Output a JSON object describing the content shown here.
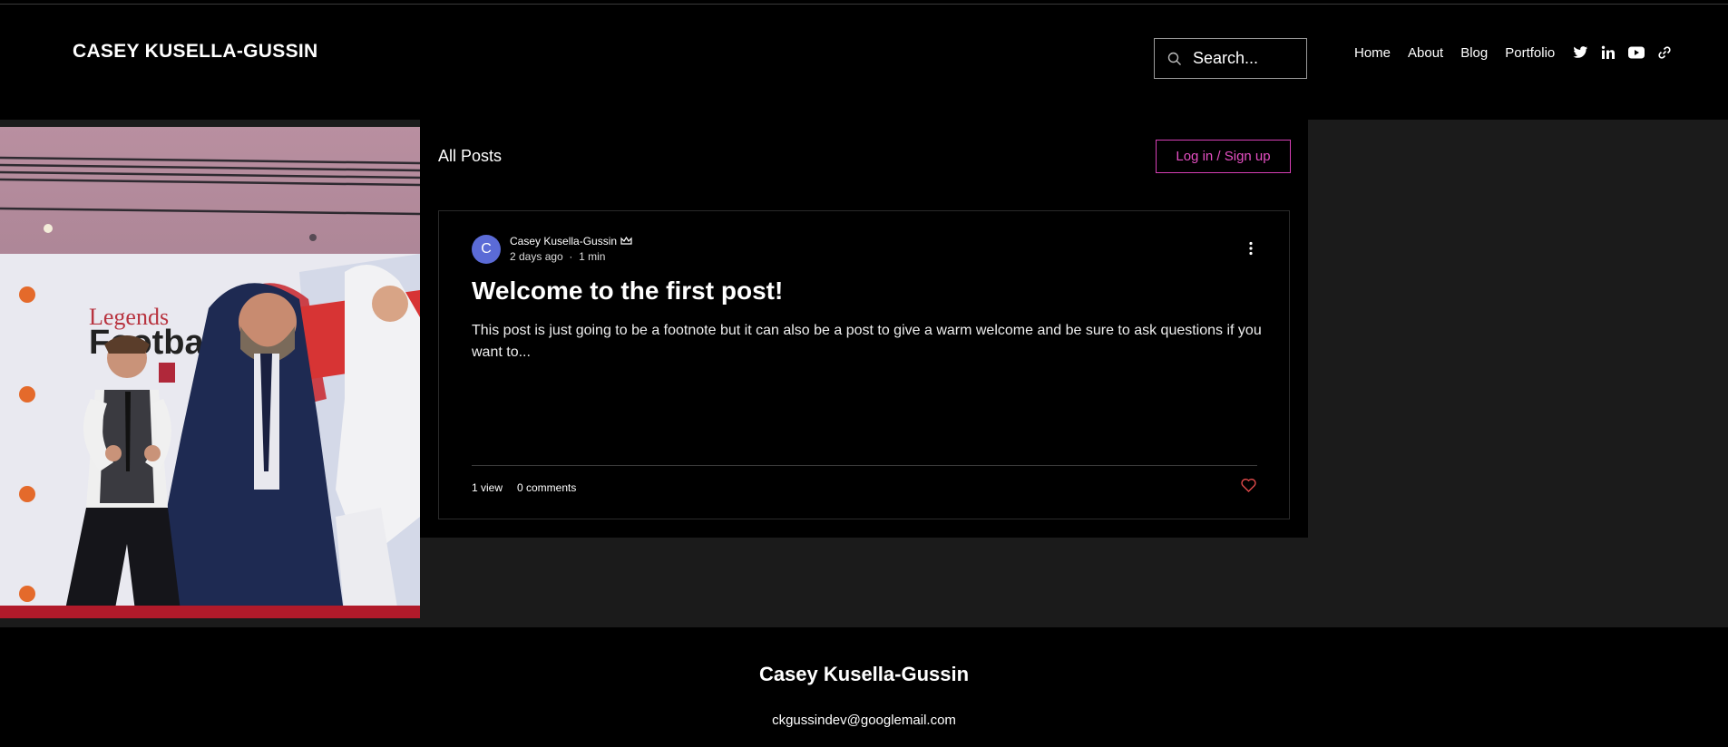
{
  "header": {
    "site_title": "CASEY KUSELLA-GUSSIN",
    "search_placeholder": "Search...",
    "nav": [
      "Home",
      "About",
      "Blog",
      "Portfolio"
    ],
    "social_icons": [
      "twitter-icon",
      "linkedin-icon",
      "youtube-icon",
      "link-icon"
    ]
  },
  "hero_image": {
    "banner_text_line1": "Legends",
    "banner_text_line2": "Football"
  },
  "feed": {
    "heading": "All Posts",
    "login_label": "Log in / Sign up",
    "post": {
      "avatar_initial": "C",
      "author": "Casey Kusella-Gussin",
      "time_ago": "2 days ago",
      "read_time": "1 min",
      "title": "Welcome to the first post!",
      "excerpt": "This post is just going to be a footnote but it can also be a post to give a warm welcome and be sure to ask questions if you want to...",
      "views": "1 view",
      "comments": "0 comments"
    }
  },
  "footer": {
    "name": "Casey Kusella-Gussin",
    "email": "ckgussindev@googlemail.com"
  },
  "colors": {
    "accent": "#e64fc3",
    "avatar": "#5b6bd6",
    "like": "#e04a4a",
    "band": "#1b1b1b"
  }
}
